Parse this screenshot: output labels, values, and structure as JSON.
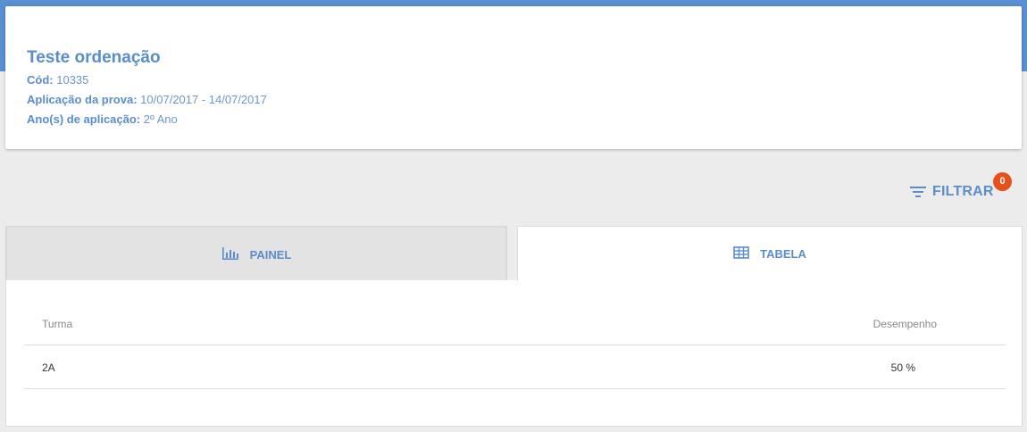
{
  "header": {
    "title": "Teste ordenação",
    "cod_label": "Cód:",
    "cod_value": "10335",
    "aplicacao_label": "Aplicação da prova:",
    "aplicacao_value": "10/07/2017 - 14/07/2017",
    "anos_label": "Ano(s) de aplicação:",
    "anos_value": "2º Ano"
  },
  "filter": {
    "label": "FILTRAR",
    "badge_count": "0",
    "icon": "filter-list-icon"
  },
  "tabs": [
    {
      "label": "PAINEL",
      "icon": "bar-chart-icon",
      "active": false
    },
    {
      "label": "TABELA",
      "icon": "table-grid-icon",
      "active": true
    }
  ],
  "table": {
    "columns": [
      "Turma",
      "Desempenho"
    ],
    "rows": [
      {
        "turma": "2A",
        "desempenho": "50 %"
      }
    ]
  },
  "colors": {
    "accent": "#5b8dcc",
    "topbar": "#5a8fd4",
    "badge": "#e8501b"
  }
}
